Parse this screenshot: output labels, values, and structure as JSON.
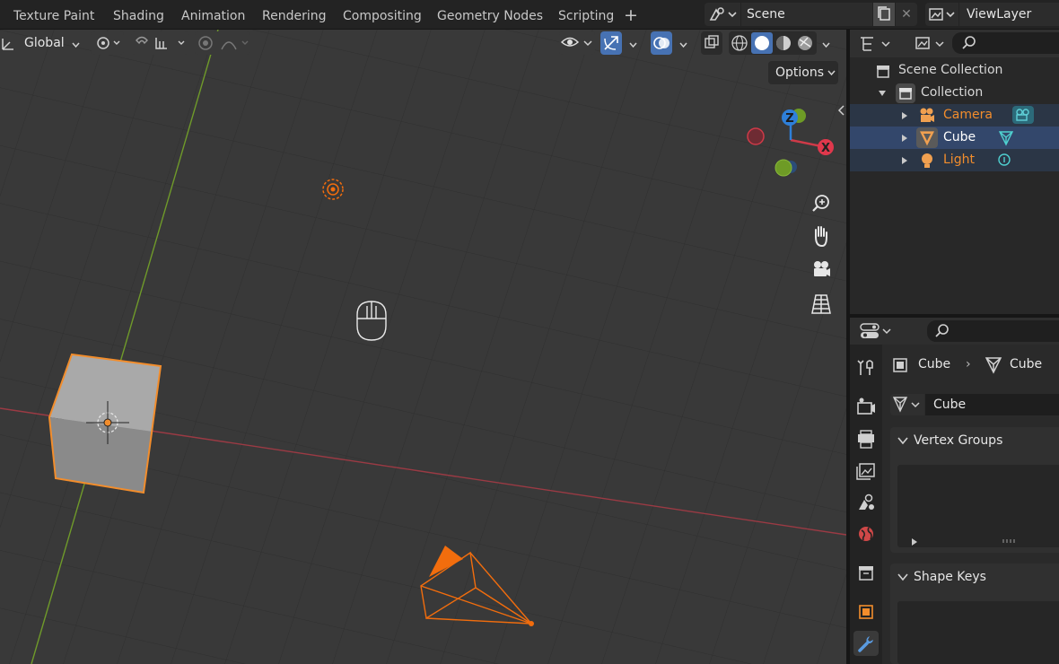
{
  "workspace_tabs": [
    {
      "label": "Texture Paint"
    },
    {
      "label": "Shading"
    },
    {
      "label": "Animation"
    },
    {
      "label": "Rendering"
    },
    {
      "label": "Compositing"
    },
    {
      "label": "Geometry Nodes"
    },
    {
      "label": "Scripting"
    }
  ],
  "topbar": {
    "add_workspace": "+",
    "scene_name": "Scene",
    "scene_remove": "✕",
    "view_layer_name": "ViewLayer"
  },
  "viewport": {
    "orientation": "Global",
    "options_label": "Options",
    "gizmo": {
      "x_label": "X",
      "z_label": "Z"
    }
  },
  "outliner": {
    "scene_collection": "Scene Collection",
    "collection": "Collection",
    "objects": [
      {
        "name": "Camera",
        "type": "camera"
      },
      {
        "name": "Cube",
        "type": "mesh"
      },
      {
        "name": "Light",
        "type": "light"
      }
    ]
  },
  "properties": {
    "breadcrumb_object": "Cube",
    "breadcrumb_sep": "›",
    "breadcrumb_data": "Cube",
    "mesh_name": "Cube",
    "panels": {
      "vertex_groups": "Vertex Groups",
      "shape_keys": "Shape Keys"
    }
  },
  "colors": {
    "accent_blue": "#4772b3",
    "selected_orange": "#f28d2c",
    "object_orange": "#f26d0d",
    "axis_x": "#cf3a48",
    "axis_y": "#6e9b26",
    "axis_z": "#2e7fd9",
    "viewport_bg": "#393939"
  }
}
